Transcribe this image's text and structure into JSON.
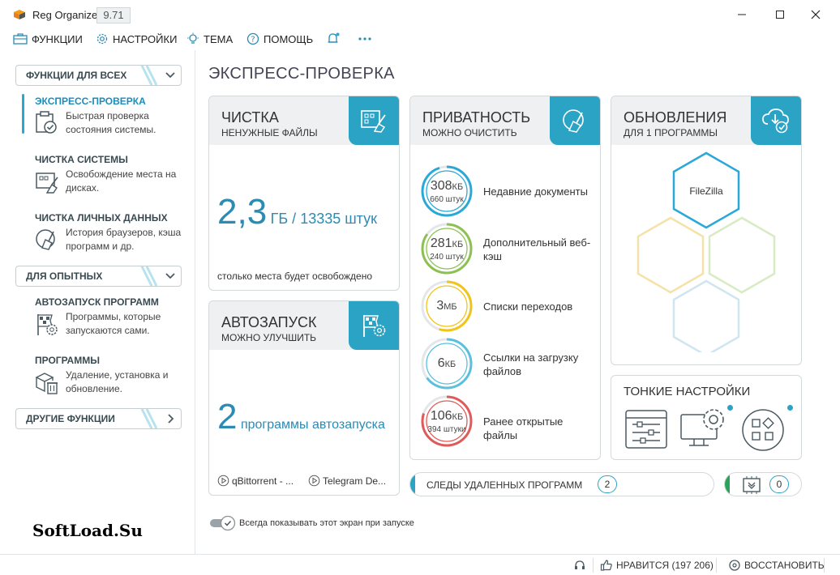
{
  "window": {
    "title": "Reg Organizer",
    "version": "9.71"
  },
  "menu": {
    "functions": "ФУНКЦИИ",
    "settings": "НАСТРОЙКИ",
    "theme": "ТЕМА",
    "help": "ПОМОЩЬ"
  },
  "sidebar": {
    "group_all": "ФУНКЦИИ ДЛЯ ВСЕХ",
    "group_advanced": "ДЛЯ ОПЫТНЫХ",
    "group_other": "ДРУГИЕ ФУНКЦИИ",
    "items": [
      {
        "title": "ЭКСПРЕСС-ПРОВЕРКА",
        "desc": "Быстрая проверка состояния системы."
      },
      {
        "title": "ЧИСТКА СИСТЕМЫ",
        "desc": "Освобождение места на дисках."
      },
      {
        "title": "ЧИСТКА ЛИЧНЫХ ДАННЫХ",
        "desc": "История браузеров, кэша программ и др."
      },
      {
        "title": "АВТОЗАПУСК ПРОГРАММ",
        "desc": "Программы, которые запускаются сами."
      },
      {
        "title": "ПРОГРАММЫ",
        "desc": "Удаление, установка и обновление."
      }
    ]
  },
  "watermark": "SoftLoad.Su",
  "main": {
    "title": "ЭКСПРЕСС-ПРОВЕРКА",
    "cleanup": {
      "title": "ЧИСТКА",
      "subtitle": "НЕНУЖНЫЕ ФАЙЛЫ",
      "value": "2,3",
      "unit": "ГБ / 13335 штук",
      "note": "столько места будет освобождено"
    },
    "autorun": {
      "title": "АВТОЗАПУСК",
      "subtitle": "МОЖНО УЛУЧШИТЬ",
      "value": "2",
      "unit": "программы автозапуска",
      "programs": [
        "qBittorrent - ...",
        "Telegram De..."
      ]
    },
    "privacy": {
      "title": "ПРИВАТНОСТЬ",
      "subtitle": "МОЖНО ОЧИСТИТЬ",
      "rows": [
        {
          "value": "308",
          "unit": "КБ",
          "count": "660 штук",
          "label": "Недавние документы",
          "color": "#2aa8d8"
        },
        {
          "value": "281",
          "unit": "КБ",
          "count": "240 штук",
          "label": "Дополнительный веб-кэш",
          "color": "#8cc152"
        },
        {
          "value": "3",
          "unit": "МБ",
          "count": "",
          "label": "Списки переходов",
          "color": "#f0c419"
        },
        {
          "value": "6",
          "unit": "КБ",
          "count": "",
          "label": "Ссылки на загрузку файлов",
          "color": "#5bc0de"
        },
        {
          "value": "106",
          "unit": "КБ",
          "count": "394 штуки",
          "label": "Ранее открытые файлы",
          "color": "#e05a5a"
        }
      ]
    },
    "updates": {
      "title": "ОБНОВЛЕНИЯ",
      "subtitle": "ДЛЯ 1 ПРОГРАММЫ",
      "program": "FileZilla"
    },
    "tweaks": {
      "title": "ТОНКИЕ НАСТРОЙКИ"
    },
    "traces": {
      "label": "СЛЕДЫ УДАЛЕННЫХ ПРОГРАММ",
      "count": "2"
    },
    "extra_count": "0",
    "always_show": "Всегда показывать этот экран при запуске"
  },
  "statusbar": {
    "like": "НРАВИТСЯ (197 206)",
    "restore": "ВОССТАНОВИТЬ"
  }
}
